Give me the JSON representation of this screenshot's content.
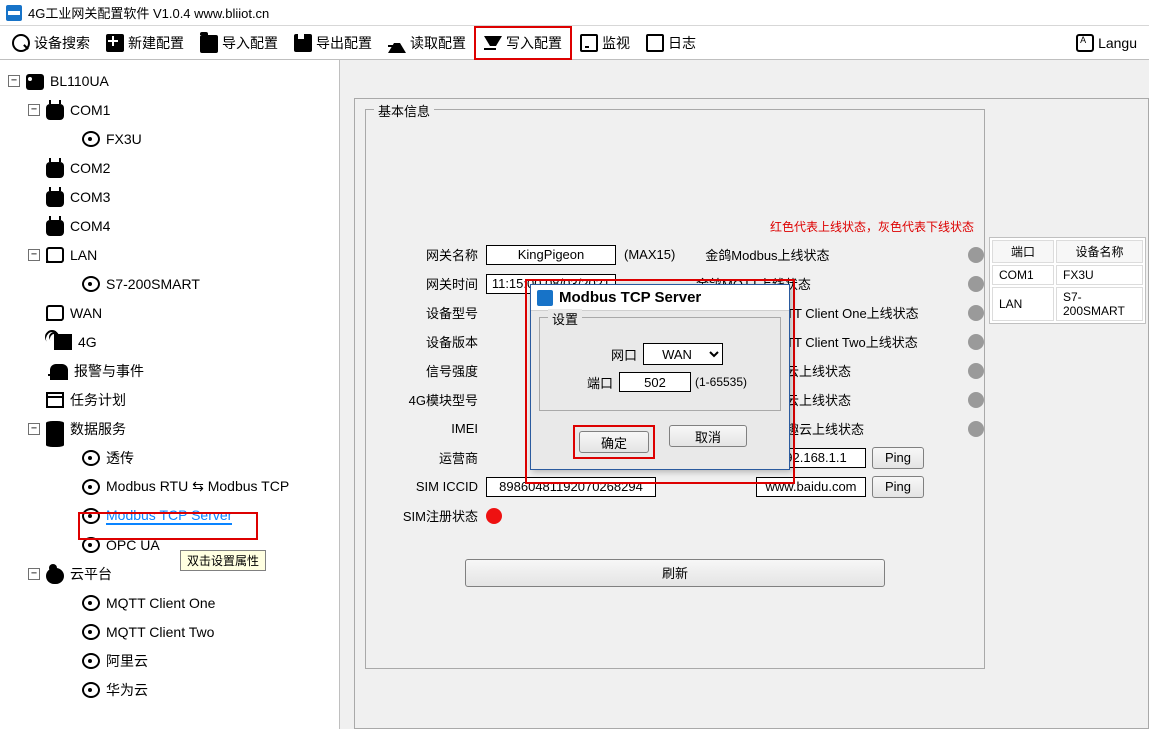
{
  "titlebar": {
    "text": "4G工业网关配置软件 V1.0.4 www.bliiot.cn"
  },
  "toolbar": {
    "search": "设备搜索",
    "new": "新建配置",
    "import": "导入配置",
    "export": "导出配置",
    "read": "读取配置",
    "write": "写入配置",
    "monitor": "监视",
    "log": "日志",
    "lang": "Langu"
  },
  "tree": {
    "root": "BL110UA",
    "com1": "COM1",
    "fx3u": "FX3U",
    "com2": "COM2",
    "com3": "COM3",
    "com4": "COM4",
    "lan": "LAN",
    "s7": "S7-200SMART",
    "wan": "WAN",
    "g4": "4G",
    "alarm": "报警与事件",
    "task": "任务计划",
    "datasvc": "数据服务",
    "pass": "透传",
    "mrtu": "Modbus RTU ⇆ Modbus TCP",
    "mtcps": "Modbus TCP Server",
    "opcua": "OPC UA",
    "cloud": "云平台",
    "mqtt1": "MQTT Client One",
    "mqtt2": "MQTT Client Two",
    "ali": "阿里云",
    "hw": "华为云"
  },
  "tooltip": "双击设置属性",
  "basic": {
    "legend": "基本信息",
    "hint": "红色代表上线状态，灰色代表下线状态",
    "rows": {
      "gwname_k": "网关名称",
      "gwname_v": "KingPigeon",
      "gwname_suffix": "(MAX15)",
      "gwtime_k": "网关时间",
      "gwtime_v": "11:15:00 08/03/2021",
      "devtype_k": "设备型号",
      "devver_k": "设备版本",
      "signal_k": "信号强度",
      "mod4g_k": "4G模块型号",
      "imei_k": "IMEI",
      "carrier_k": "运营商",
      "iccid_k": "SIM ICCID",
      "iccid_v": "89860481192070268294",
      "simreg_k": "SIM注册状态"
    },
    "status": {
      "s1": "金鸽Modbus上线状态",
      "s2": "金鸽MQTT上线状态",
      "s3": "TT Client One上线状态",
      "s4": "TT Client Two上线状态",
      "s5": "云上线状态",
      "s6": "云上线状态",
      "s7": "趣云上线状态"
    },
    "ip": "92.168.1.1",
    "ping": "Ping",
    "url": "www.baidu.com",
    "refresh": "刷新"
  },
  "devtable": {
    "h_port": "端口",
    "h_name": "设备名称",
    "rows": [
      {
        "port": "COM1",
        "name": "FX3U"
      },
      {
        "port": "LAN",
        "name": "S7-200SMART"
      }
    ]
  },
  "dialog": {
    "title": "Modbus TCP Server",
    "legend": "设置",
    "netport_k": "网口",
    "netport_v": "WAN",
    "port_k": "端口",
    "port_v": "502",
    "port_range": "(1-65535)",
    "ok": "确定",
    "cancel": "取消"
  }
}
